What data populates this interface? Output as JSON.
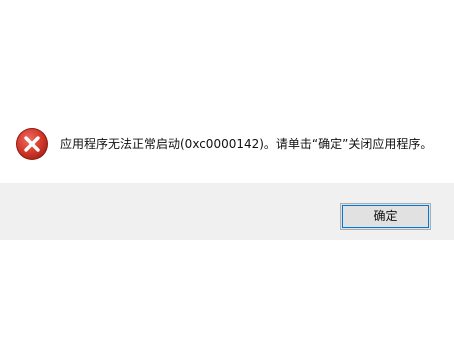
{
  "dialog": {
    "icon": "error-icon",
    "message": "应用程序无法正常启动(0xc0000142)。请单击“确定”关闭应用程序。",
    "ok_label": "确定"
  },
  "colors": {
    "error_red": "#c42b1c",
    "footer_bg": "#f0f0f0",
    "button_bg": "#e1e1e1",
    "button_focus": "#0078d7"
  }
}
